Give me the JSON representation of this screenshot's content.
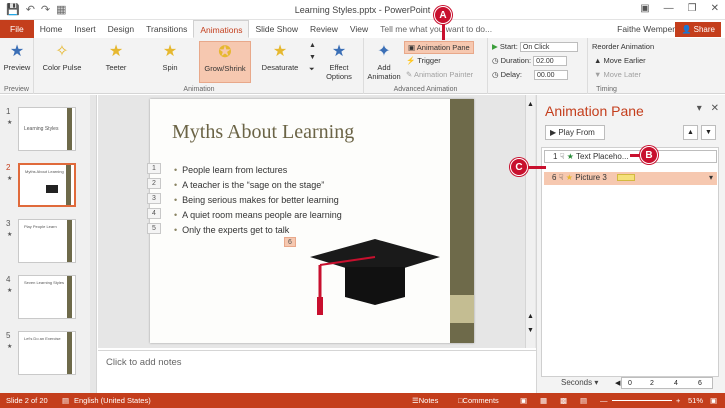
{
  "window": {
    "title": "Learning Styles.pptx - PowerPoint"
  },
  "tabs": {
    "file": "File",
    "items": [
      "Home",
      "Insert",
      "Design",
      "Transitions",
      "Animations",
      "Slide Show",
      "Review",
      "View"
    ],
    "tellme": "Tell me what you want to do...",
    "user": "Faithe Wempen",
    "share": "Share"
  },
  "ribbon": {
    "preview": {
      "label": "Preview",
      "group": "Preview"
    },
    "animations": [
      "Color Pulse",
      "Teeter",
      "Spin",
      "Grow/Shrink",
      "Desaturate"
    ],
    "effect_options": "Effect Options",
    "animation_group": "Animation",
    "add_animation": "Add Animation",
    "animation_pane": "Animation Pane",
    "trigger": "Trigger",
    "animation_painter": "Animation Painter",
    "advanced_group": "Advanced Animation",
    "start_label": "Start:",
    "start_value": "On Click",
    "duration_label": "Duration:",
    "duration_value": "02.00",
    "delay_label": "Delay:",
    "delay_value": "00.00",
    "timing_group": "Timing",
    "reorder": "Reorder Animation",
    "move_earlier": "Move Earlier",
    "move_later": "Move Later"
  },
  "thumbnails": [
    {
      "num": "1",
      "title": "Learning Styles"
    },
    {
      "num": "2",
      "title": "Myths About Learning"
    },
    {
      "num": "3",
      "title": "Play People Learn"
    },
    {
      "num": "4",
      "title": "Seven Learning Styles"
    },
    {
      "num": "5",
      "title": "Let's Do an Exercise"
    }
  ],
  "slide": {
    "title": "Myths About Learning",
    "bullets": [
      "People learn from lectures",
      "A teacher is the “sage on the stage”",
      "Being serious makes for better learning",
      "A quiet room means people are learning",
      "Only the experts get to talk"
    ],
    "tags": [
      "1",
      "2",
      "3",
      "4",
      "5"
    ],
    "tag6": "6"
  },
  "notes": "Click to add notes",
  "pane": {
    "title": "Animation Pane",
    "play_from": "Play From",
    "items": [
      {
        "num": "1",
        "name": "Text Placeho..."
      },
      {
        "num": "6",
        "name": "Picture 3"
      }
    ],
    "seconds": "Seconds",
    "scale": [
      "0",
      "2",
      "4",
      "6"
    ]
  },
  "status": {
    "slide": "Slide 2 of 20",
    "lang": "English (United States)",
    "notes": "Notes",
    "comments": "Comments",
    "zoom": "51%"
  },
  "callouts": {
    "a": "A",
    "b": "B",
    "c": "C"
  },
  "colors": {
    "accent": "#c43e1c",
    "callout": "#c8102e",
    "selected": "#f6c8b0"
  }
}
